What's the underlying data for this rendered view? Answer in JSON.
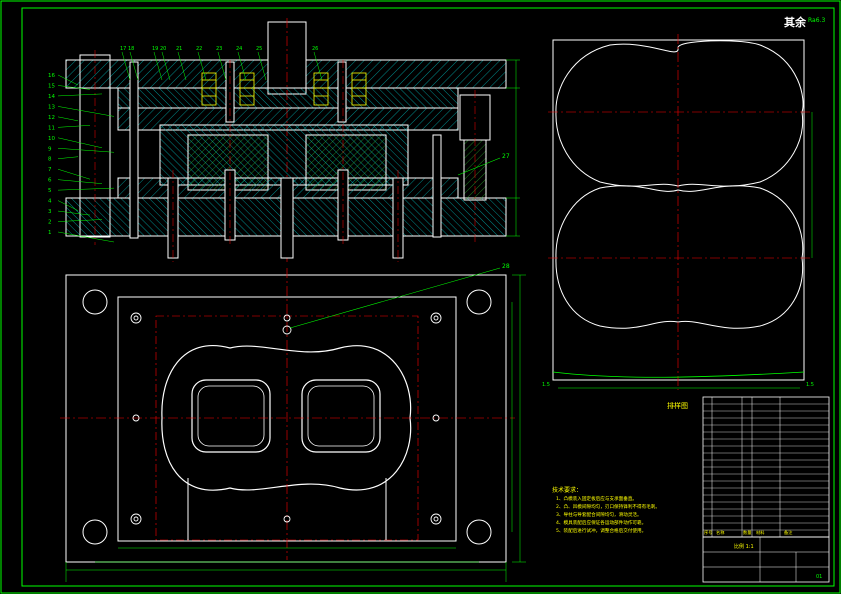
{
  "title_block": {
    "corner_mark": "其余",
    "roughness": "Ra6.3",
    "scale_note": "比例 1:1",
    "page_number": "01"
  },
  "part_labels": {
    "left": [
      "16",
      "15",
      "14",
      "13",
      "12",
      "11",
      "10",
      "9",
      "8",
      "7",
      "6",
      "5",
      "4",
      "3",
      "2",
      "1"
    ],
    "top": [
      "17",
      "18",
      "19",
      "20",
      "21",
      "22",
      "23",
      "24",
      "25",
      "26"
    ],
    "right_27": "27",
    "right_28": "28"
  },
  "blank_view": {
    "title": "排样图",
    "left_mark": "1.5",
    "right_mark": "1.5"
  },
  "tech_requirements": {
    "heading": "技术要求：",
    "items": [
      "1、凸模装入固定板后应与支承面垂直。",
      "2、凸、凹模间隙均匀，刃口保持锋利不得有毛刺。",
      "3、导柱与导套配合间隙均匀，滑动灵活。",
      "4、模具装配后应保证各运动部件动作可靠。",
      "5、装配后进行试冲，调整合格后交付使用。"
    ]
  },
  "bom_header": [
    "序号",
    "名称",
    "数量",
    "材料",
    "备注"
  ],
  "colors": {
    "frame": "#00ff00",
    "outline": "#ffffff",
    "centerline": "#ff0000",
    "hatch": "#00ffff",
    "dimension": "#00ff00",
    "label": "#ffff00"
  }
}
